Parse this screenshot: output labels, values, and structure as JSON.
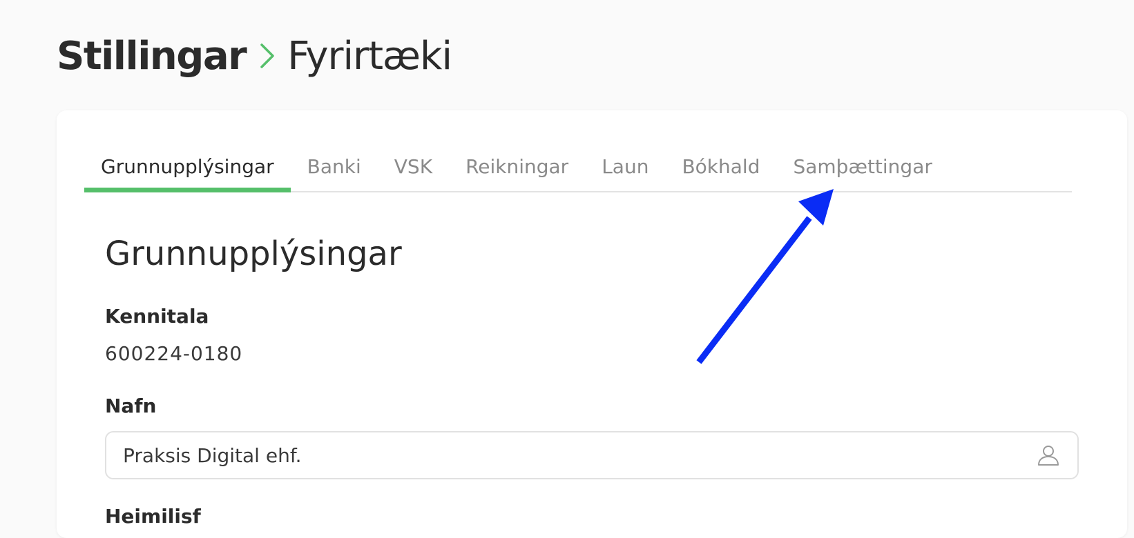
{
  "breadcrumb": {
    "parent": "Stillingar",
    "separator_icon": "chevron-right-icon",
    "current": "Fyrirtæki"
  },
  "tabs": [
    {
      "label": "Grunnupplýsingar",
      "active": true
    },
    {
      "label": "Banki",
      "active": false
    },
    {
      "label": "VSK",
      "active": false
    },
    {
      "label": "Reikningar",
      "active": false
    },
    {
      "label": "Laun",
      "active": false
    },
    {
      "label": "Bókhald",
      "active": false
    },
    {
      "label": "Samþættingar",
      "active": false
    }
  ],
  "section": {
    "title": "Grunnupplýsingar"
  },
  "fields": {
    "kennitala": {
      "label": "Kennitala",
      "value": "600224-0180"
    },
    "nafn": {
      "label": "Nafn",
      "value": "Praksis Digital ehf.",
      "icon": "user-icon"
    },
    "next_label_partial": "Heimilisf"
  },
  "colors": {
    "accent": "#55bf6a",
    "annotation_arrow": "#0a2cf5",
    "page_bg": "#fafafa",
    "card_bg": "#ffffff"
  },
  "annotation": {
    "type": "arrow",
    "points_to": "Samþættingar"
  }
}
